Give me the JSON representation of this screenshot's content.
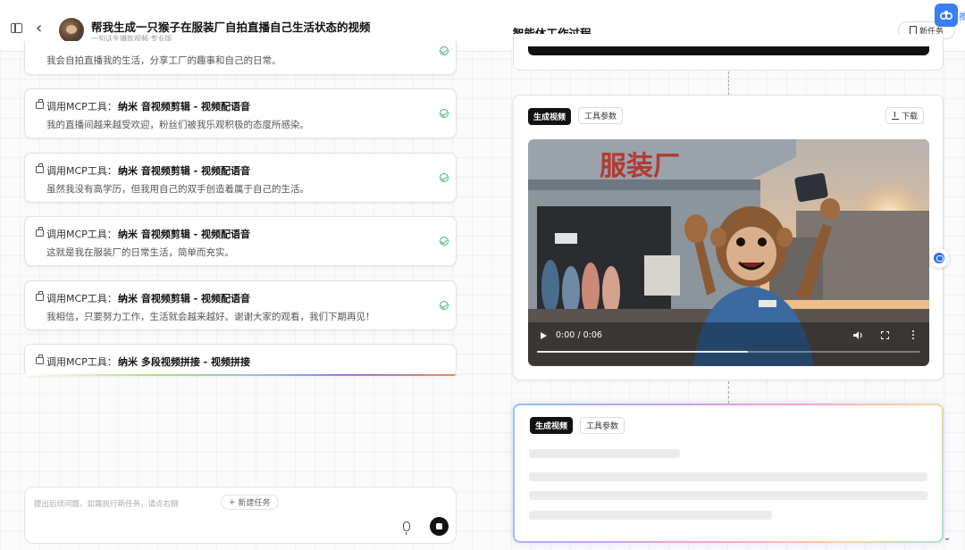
{
  "header": {
    "title": "帮我生成一只猴子在服装厂自拍直播自己生活状态的视频",
    "subtitle": "一句话生爆款视频·专业版",
    "panel_title": "智能体工作过程",
    "new_task_label": "新任务",
    "corner_label": "推"
  },
  "steps": [
    {
      "text": "我会自拍直播我的生活，分享工厂的趣事和自己的日常。",
      "status": "done"
    },
    {
      "prefix": "调用MCP工具：",
      "tool": "纳米 音视频剪辑 - 视频配语音",
      "text": "我的直播间越来越受欢迎，粉丝们被我乐观积极的态度所感染。",
      "status": "done"
    },
    {
      "prefix": "调用MCP工具：",
      "tool": "纳米 音视频剪辑 - 视频配语音",
      "text": "虽然我没有高学历，但我用自己的双手创造着属于自己的生活。",
      "status": "done"
    },
    {
      "prefix": "调用MCP工具：",
      "tool": "纳米 音视频剪辑 - 视频配语音",
      "text": "这就是我在服装厂的日常生活，简单而充实。",
      "status": "done"
    },
    {
      "prefix": "调用MCP工具：",
      "tool": "纳米 音视频剪辑 - 视频配语音",
      "text": "我相信，只要努力工作，生活就会越来越好。谢谢大家的观看，我们下期再见！",
      "status": "done"
    },
    {
      "prefix": "调用MCP工具：",
      "tool": "纳米 多段视频拼接 - 视频拼接",
      "status": "running"
    }
  ],
  "input": {
    "placeholder": "提出后续问题，如需执行新任务，请点右侧",
    "new_task_chip": "新建任务"
  },
  "video_card": {
    "tab_active": "生成视频",
    "tab_params": "工具参数",
    "download_label": "下载",
    "time": "0:00 / 0:06",
    "progress": 0.55,
    "factory_sign": "服装厂"
  },
  "gen_card": {
    "tab_active": "生成视频",
    "tab_params": "工具参数"
  },
  "icons": [
    "sidebar-toggle-icon",
    "back-icon",
    "avatar",
    "doc-icon",
    "briefcase-icon",
    "check-circle-icon",
    "mic-icon",
    "stop-icon",
    "download-icon",
    "play-icon",
    "volume-icon",
    "fullscreen-icon",
    "more-icon",
    "chat-bubble-icon",
    "chevron-down-icon"
  ],
  "colors": {
    "accent": "#3b7df5",
    "success": "#3cb371",
    "dark": "#111111"
  }
}
